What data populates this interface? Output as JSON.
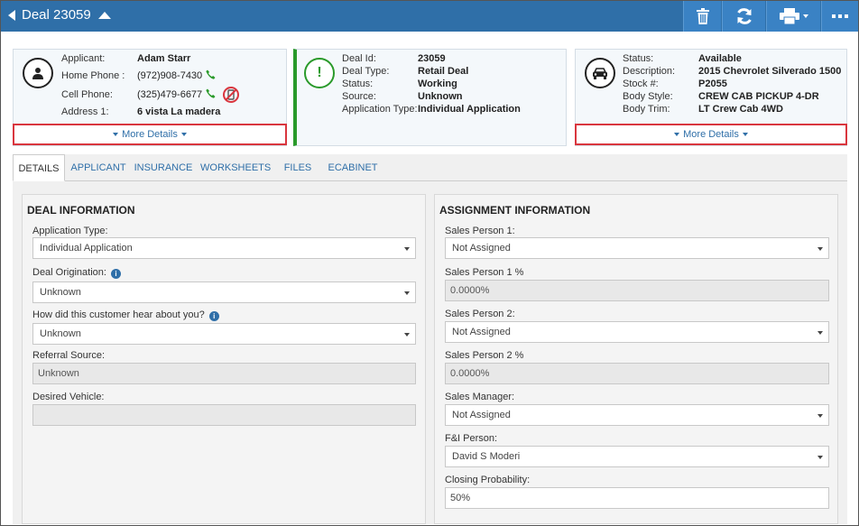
{
  "header": {
    "title": "Deal 23059"
  },
  "icons": {
    "back": "triangle-left-icon",
    "collapse": "triangle-up-icon",
    "delete": "trash-icon",
    "refresh": "refresh-icon",
    "print": "printer-icon",
    "more": "ellipsis-icon"
  },
  "applicant": {
    "applicant_label": "Applicant:",
    "applicant_value": "Adam Starr",
    "home_phone_label": "Home Phone :",
    "home_phone_value": "(972)908-7430",
    "cell_phone_label": "Cell Phone:",
    "cell_phone_value": "(325)479-6677",
    "address_label": "Address 1:",
    "address_value": "6 vista La madera",
    "more_details": "More Details"
  },
  "deal": {
    "deal_id_label": "Deal Id:",
    "deal_id_value": "23059",
    "deal_type_label": "Deal Type:",
    "deal_type_value": "Retail Deal",
    "status_label": "Status:",
    "status_value": "Working",
    "source_label": "Source:",
    "source_value": "Unknown",
    "app_type_label": "Application Type:",
    "app_type_value": "Individual Application"
  },
  "vehicle": {
    "status_label": "Status:",
    "status_value": "Available",
    "description_label": "Description:",
    "description_value": "2015 Chevrolet Silverado 1500",
    "stock_label": "Stock #:",
    "stock_value": "P2055",
    "body_style_label": "Body Style:",
    "body_style_value": "CREW CAB PICKUP 4-DR",
    "body_trim_label": "Body Trim:",
    "body_trim_value": "LT Crew Cab 4WD",
    "more_details": "More Details"
  },
  "tabs": [
    {
      "label": "DETAILS"
    },
    {
      "label": "APPLICANT"
    },
    {
      "label": "INSURANCE"
    },
    {
      "label": "WORKSHEETS"
    },
    {
      "label": "FILES"
    },
    {
      "label": "ECABINET"
    }
  ],
  "deal_info": {
    "heading": "DEAL INFORMATION",
    "application_type_label": "Application Type:",
    "application_type_value": "Individual Application",
    "deal_origination_label": "Deal Origination:",
    "deal_origination_value": "Unknown",
    "hear_label": "How did this customer hear about you?",
    "hear_value": "Unknown",
    "referral_label": "Referral Source:",
    "referral_value": "Unknown",
    "desired_vehicle_label": "Desired Vehicle:",
    "desired_vehicle_value": ""
  },
  "assignment": {
    "heading": "ASSIGNMENT INFORMATION",
    "sp1_label": "Sales Person 1:",
    "sp1_value": "Not Assigned",
    "sp1_pct_label": "Sales Person 1 %",
    "sp1_pct_value": "0.0000%",
    "sp2_label": "Sales Person 2:",
    "sp2_value": "Not Assigned",
    "sp2_pct_label": "Sales Person 2 %",
    "sp2_pct_value": "0.0000%",
    "manager_label": "Sales Manager:",
    "manager_value": "Not Assigned",
    "fi_label": "F&I Person:",
    "fi_value": "David S Moderi",
    "closing_label": "Closing Probability:",
    "closing_value": "50%"
  },
  "colors": {
    "header_bg": "#2f6fa8",
    "accent_green": "#2a9a2a",
    "highlight_red": "#d9363e"
  }
}
